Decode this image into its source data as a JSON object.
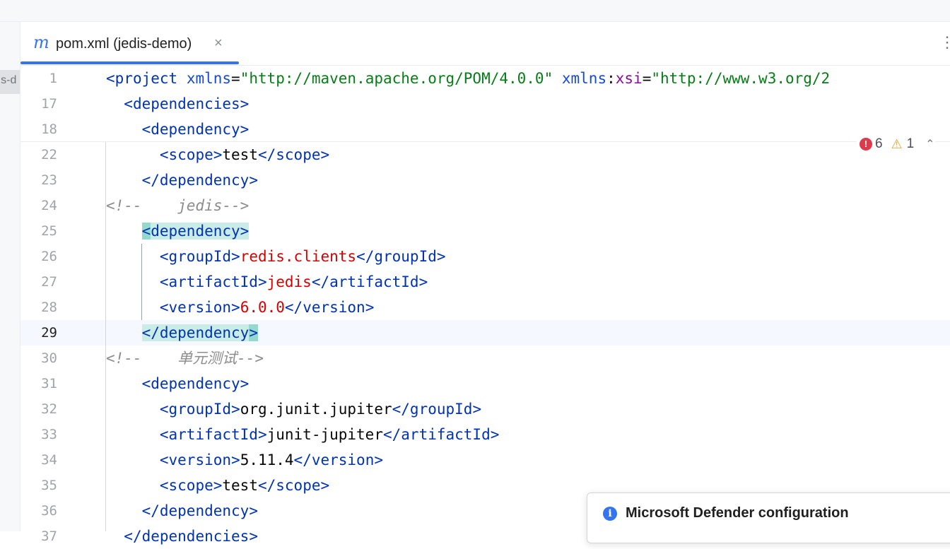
{
  "side_panel": {
    "label": "lis-d"
  },
  "tab": {
    "icon": "maven-m-icon",
    "icon_glyph": "m",
    "label": "pom.xml (jedis-demo)",
    "close_glyph": "×"
  },
  "more_glyph": "⋮",
  "inspections": {
    "errors": "6",
    "warnings": "1",
    "collapse_glyph": "⌃"
  },
  "editor": {
    "caret_line": "29",
    "lines": [
      {
        "num": "1",
        "indent": "",
        "tokens": [
          {
            "t": "<",
            "c": "tk-tag"
          },
          {
            "t": "project",
            "c": "tk-tag"
          },
          {
            "t": " ",
            "c": "tk-text"
          },
          {
            "t": "xmlns",
            "c": "tk-attr"
          },
          {
            "t": "=",
            "c": "tk-text"
          },
          {
            "t": "\"http://maven.apache.org/POM/4.0.0\"",
            "c": "tk-str"
          },
          {
            "t": " ",
            "c": "tk-text"
          },
          {
            "t": "xmlns",
            "c": "tk-attr"
          },
          {
            "t": ":",
            "c": "tk-text"
          },
          {
            "t": "xsi",
            "c": "tk-ns"
          },
          {
            "t": "=",
            "c": "tk-text"
          },
          {
            "t": "\"http://www.w3.org/2",
            "c": "tk-str"
          }
        ]
      },
      {
        "num": "17",
        "indent": "  ",
        "tokens": [
          {
            "t": "<",
            "c": "tk-tag"
          },
          {
            "t": "dependencies",
            "c": "tk-tag"
          },
          {
            "t": ">",
            "c": "tk-tag"
          }
        ]
      },
      {
        "num": "18",
        "indent": "    ",
        "tokens": [
          {
            "t": "<",
            "c": "tk-tag"
          },
          {
            "t": "dependency",
            "c": "tk-tag"
          },
          {
            "t": ">",
            "c": "tk-tag"
          }
        ]
      },
      {
        "num": "22",
        "indent": "      ",
        "tokens": [
          {
            "t": "<",
            "c": "tk-tag"
          },
          {
            "t": "scope",
            "c": "tk-tag"
          },
          {
            "t": ">",
            "c": "tk-tag"
          },
          {
            "t": "test",
            "c": "tk-text"
          },
          {
            "t": "</",
            "c": "tk-tag"
          },
          {
            "t": "scope",
            "c": "tk-tag"
          },
          {
            "t": ">",
            "c": "tk-tag"
          }
        ]
      },
      {
        "num": "23",
        "indent": "    ",
        "tokens": [
          {
            "t": "</",
            "c": "tk-tag"
          },
          {
            "t": "dependency",
            "c": "tk-tag"
          },
          {
            "t": ">",
            "c": "tk-tag"
          }
        ]
      },
      {
        "num": "24",
        "indent": "",
        "tokens": [
          {
            "t": "<!--    jedis-->",
            "c": "tk-com"
          }
        ]
      },
      {
        "num": "25",
        "indent": "    ",
        "tokens": [
          {
            "t": "<",
            "c": "tk-tag hlb"
          },
          {
            "t": "dependency",
            "c": "tk-tag hl"
          },
          {
            "t": ">",
            "c": "tk-tag hl"
          }
        ]
      },
      {
        "num": "26",
        "indent": "      ",
        "tokens": [
          {
            "t": "<",
            "c": "tk-tag"
          },
          {
            "t": "groupId",
            "c": "tk-tag"
          },
          {
            "t": ">",
            "c": "tk-tag"
          },
          {
            "t": "redis.clients",
            "c": "tk-val"
          },
          {
            "t": "</",
            "c": "tk-tag"
          },
          {
            "t": "groupId",
            "c": "tk-tag"
          },
          {
            "t": ">",
            "c": "tk-tag"
          }
        ]
      },
      {
        "num": "27",
        "indent": "      ",
        "tokens": [
          {
            "t": "<",
            "c": "tk-tag"
          },
          {
            "t": "artifactId",
            "c": "tk-tag"
          },
          {
            "t": ">",
            "c": "tk-tag"
          },
          {
            "t": "jedis",
            "c": "tk-val"
          },
          {
            "t": "</",
            "c": "tk-tag"
          },
          {
            "t": "artifactId",
            "c": "tk-tag"
          },
          {
            "t": ">",
            "c": "tk-tag"
          }
        ]
      },
      {
        "num": "28",
        "indent": "      ",
        "tokens": [
          {
            "t": "<",
            "c": "tk-tag"
          },
          {
            "t": "version",
            "c": "tk-tag"
          },
          {
            "t": ">",
            "c": "tk-tag"
          },
          {
            "t": "6.0.0",
            "c": "tk-val"
          },
          {
            "t": "</",
            "c": "tk-tag"
          },
          {
            "t": "version",
            "c": "tk-tag"
          },
          {
            "t": ">",
            "c": "tk-tag"
          }
        ]
      },
      {
        "num": "29",
        "indent": "    ",
        "tokens": [
          {
            "t": "</",
            "c": "tk-tag hl"
          },
          {
            "t": "dependency",
            "c": "tk-tag hl"
          },
          {
            "t": ">",
            "c": "tk-tag hlb"
          }
        ]
      },
      {
        "num": "30",
        "indent": "",
        "tokens": [
          {
            "t": "<!--    单元测试-->",
            "c": "tk-com"
          }
        ]
      },
      {
        "num": "31",
        "indent": "    ",
        "tokens": [
          {
            "t": "<",
            "c": "tk-tag"
          },
          {
            "t": "dependency",
            "c": "tk-tag"
          },
          {
            "t": ">",
            "c": "tk-tag"
          }
        ]
      },
      {
        "num": "32",
        "indent": "      ",
        "tokens": [
          {
            "t": "<",
            "c": "tk-tag"
          },
          {
            "t": "groupId",
            "c": "tk-tag"
          },
          {
            "t": ">",
            "c": "tk-tag"
          },
          {
            "t": "org.junit.jupiter",
            "c": "tk-text"
          },
          {
            "t": "</",
            "c": "tk-tag"
          },
          {
            "t": "groupId",
            "c": "tk-tag"
          },
          {
            "t": ">",
            "c": "tk-tag"
          }
        ]
      },
      {
        "num": "33",
        "indent": "      ",
        "tokens": [
          {
            "t": "<",
            "c": "tk-tag"
          },
          {
            "t": "artifactId",
            "c": "tk-tag"
          },
          {
            "t": ">",
            "c": "tk-tag"
          },
          {
            "t": "junit-jupiter",
            "c": "tk-text"
          },
          {
            "t": "</",
            "c": "tk-tag"
          },
          {
            "t": "artifactId",
            "c": "tk-tag"
          },
          {
            "t": ">",
            "c": "tk-tag"
          }
        ]
      },
      {
        "num": "34",
        "indent": "      ",
        "tokens": [
          {
            "t": "<",
            "c": "tk-tag"
          },
          {
            "t": "version",
            "c": "tk-tag"
          },
          {
            "t": ">",
            "c": "tk-tag"
          },
          {
            "t": "5.11.4",
            "c": "tk-text"
          },
          {
            "t": "</",
            "c": "tk-tag"
          },
          {
            "t": "version",
            "c": "tk-tag"
          },
          {
            "t": ">",
            "c": "tk-tag"
          }
        ]
      },
      {
        "num": "35",
        "indent": "      ",
        "tokens": [
          {
            "t": "<",
            "c": "tk-tag"
          },
          {
            "t": "scope",
            "c": "tk-tag"
          },
          {
            "t": ">",
            "c": "tk-tag"
          },
          {
            "t": "test",
            "c": "tk-text"
          },
          {
            "t": "</",
            "c": "tk-tag"
          },
          {
            "t": "scope",
            "c": "tk-tag"
          },
          {
            "t": ">",
            "c": "tk-tag"
          }
        ]
      },
      {
        "num": "36",
        "indent": "    ",
        "tokens": [
          {
            "t": "</",
            "c": "tk-tag"
          },
          {
            "t": "dependency",
            "c": "tk-tag"
          },
          {
            "t": ">",
            "c": "tk-tag"
          }
        ]
      },
      {
        "num": "37",
        "indent": "  ",
        "tokens": [
          {
            "t": "</",
            "c": "tk-tag"
          },
          {
            "t": "dependencies",
            "c": "tk-tag"
          },
          {
            "t": ">",
            "c": "tk-tag"
          }
        ]
      }
    ]
  },
  "notification": {
    "icon": "info-icon",
    "icon_glyph": "i",
    "title": "Microsoft Defender configuration"
  },
  "colors": {
    "accent": "#3574f0",
    "tag": "#0033b3",
    "string": "#067d17",
    "value": "#d60000",
    "comment": "#8c8c8c",
    "error": "#db3b4b",
    "warning": "#d9a343",
    "match_highlight": "#c9ece7"
  }
}
